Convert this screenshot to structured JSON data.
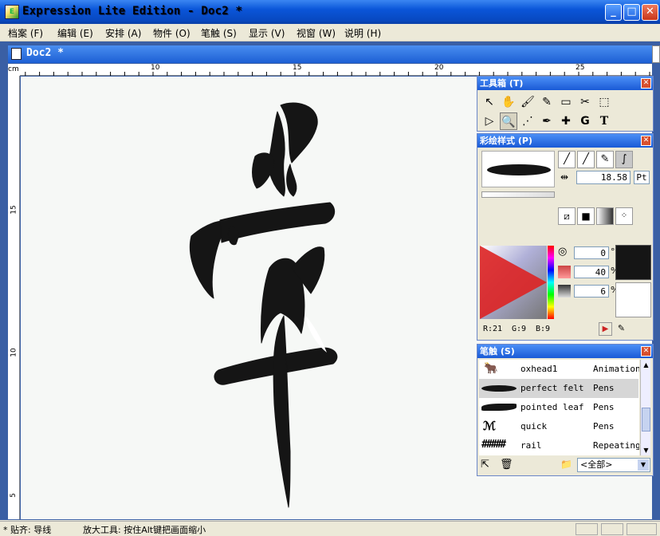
{
  "window": {
    "title": "Expression Lite Edition - Doc2 *",
    "app_icon_text": "E"
  },
  "titlebar": {
    "minimize": "_",
    "maximize": "□",
    "close": "✕"
  },
  "menu": [
    {
      "label": "档案 (F)"
    },
    {
      "label": "编辑 (E)"
    },
    {
      "label": "安排 (A)"
    },
    {
      "label": "物件 (O)"
    },
    {
      "label": "笔触 (S)"
    },
    {
      "label": "显示 (V)"
    },
    {
      "label": "视窗 (W)"
    },
    {
      "label": "说明 (H)"
    }
  ],
  "document": {
    "tab_title": "Doc2 *"
  },
  "ruler": {
    "unit": "cm",
    "top_labels": [
      "10",
      "15",
      "20",
      "25"
    ],
    "left_labels": [
      "15",
      "10",
      "5"
    ]
  },
  "toolbox": {
    "title": "工具箱 (T)",
    "tools_row1": [
      "select-arrow",
      "hand",
      "brush",
      "eyedropper",
      "rectangle",
      "scissors",
      "marquee"
    ],
    "tools_row2": [
      "direct-select",
      "zoom",
      "path-edit",
      "pen",
      "node-add",
      "rotate",
      "text"
    ],
    "text_tool_label": "T",
    "rotate_tool_label": "G"
  },
  "paint_style": {
    "title": "彩绘样式 (P)",
    "width_value": "18.58",
    "width_unit": "Pt",
    "hue_value": "0",
    "hue_unit": "°",
    "sat_value": "40",
    "sat_unit": "%",
    "light_value": "6",
    "light_unit": "%",
    "rgb": {
      "r": "R:21",
      "g": "G:9",
      "b": "B:9"
    },
    "current_color": "#151515"
  },
  "brushes": {
    "title": "笔触 (S)",
    "items": [
      {
        "name": "oxhead1",
        "type": "Animation"
      },
      {
        "name": "perfect felt",
        "type": "Pens"
      },
      {
        "name": "pointed leaf",
        "type": "Pens"
      },
      {
        "name": "quick",
        "type": "Pens"
      },
      {
        "name": "rail",
        "type": "Repeating"
      }
    ],
    "selected_index": 1,
    "filter": "<全部>"
  },
  "status": {
    "snap": "* 贴齐: 导线",
    "hint": "放大工具: 按住Alt键把画面缩小"
  },
  "colors": {
    "titlebar": "#0a55d8",
    "panel_bg": "#ece9d8",
    "ink": "#151515"
  }
}
